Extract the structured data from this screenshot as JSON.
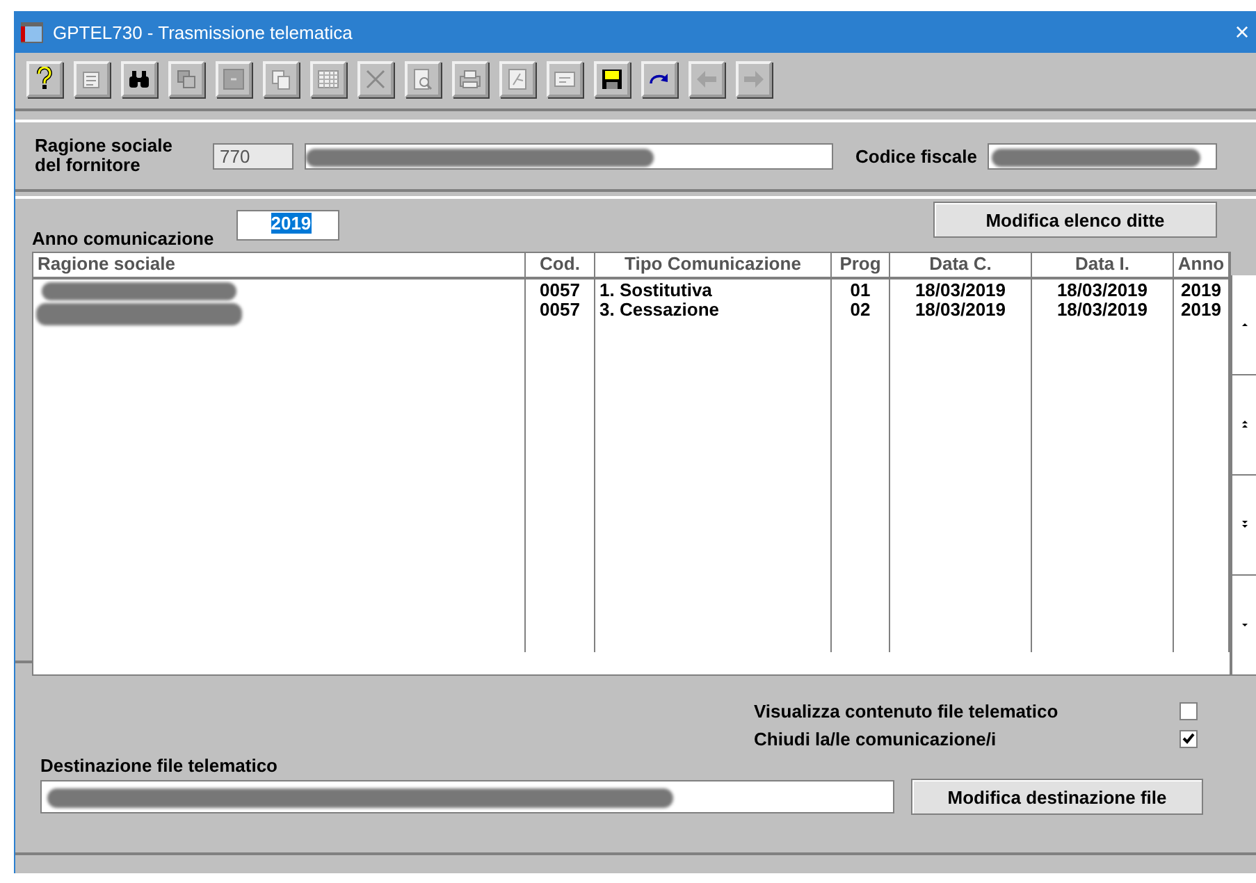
{
  "window": {
    "title": "GPTEL730 - Trasmissione telematica",
    "close": "×"
  },
  "toolbar": [
    {
      "kind": "help",
      "disabled": false
    },
    {
      "kind": "properties",
      "disabled": true
    },
    {
      "kind": "binoculars",
      "disabled": false
    },
    {
      "kind": "layers",
      "disabled": true
    },
    {
      "kind": "minus",
      "disabled": true
    },
    {
      "kind": "copy",
      "disabled": true
    },
    {
      "kind": "grid",
      "disabled": true
    },
    {
      "kind": "cross",
      "disabled": true
    },
    {
      "kind": "preview",
      "disabled": true
    },
    {
      "kind": "printer",
      "disabled": true
    },
    {
      "kind": "pdf",
      "disabled": true
    },
    {
      "kind": "card",
      "disabled": true
    },
    {
      "kind": "save",
      "disabled": false
    },
    {
      "kind": "redo",
      "disabled": false
    },
    {
      "kind": "left",
      "disabled": true
    },
    {
      "kind": "right",
      "disabled": true
    }
  ],
  "supplier": {
    "label": "Ragione sociale del fornitore",
    "code": "770",
    "tax_code_label": "Codice fiscale"
  },
  "communications": {
    "year_label": "Anno comunicazione",
    "year": "2019",
    "edit_button": "Modifica elenco ditte",
    "columns": [
      "Ragione sociale",
      "Cod.",
      "Tipo Comunicazione",
      "Prog",
      "Data C.",
      "Data I.",
      "Anno"
    ],
    "rows": [
      [
        "",
        "0057",
        "1. Sostitutiva",
        "01",
        "18/03/2019",
        "18/03/2019",
        "2019"
      ],
      [
        "",
        "0057",
        "3. Cessazione",
        "02",
        "18/03/2019",
        "18/03/2019",
        "2019"
      ]
    ]
  },
  "export": {
    "options": [
      {
        "label": "Visualizza contenuto file telematico",
        "checked": false
      },
      {
        "label": "Chiudi la/le comunicazione/i",
        "checked": true
      }
    ],
    "destination_label": "Destinazione file telematico",
    "destination_button": "Modifica destinazione file"
  }
}
